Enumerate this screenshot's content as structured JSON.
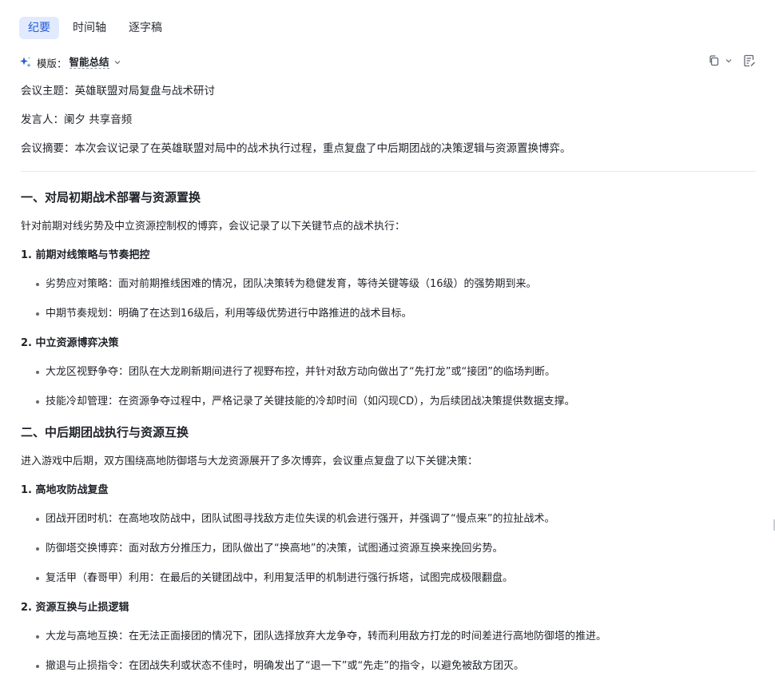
{
  "tabs": [
    {
      "label": "纪要",
      "active": true
    },
    {
      "label": "时间轴",
      "active": false
    },
    {
      "label": "逐字稿",
      "active": false
    }
  ],
  "template": {
    "label": "模版：",
    "value": "智能总结",
    "icon": "sparkle-icon"
  },
  "toolbar_icons": [
    "copy-icon",
    "chevron-down-icon",
    "edit-note-icon"
  ],
  "meta": {
    "topic": "会议主题：英雄联盟对局复盘与战术研讨",
    "speaker": "发言人：阑夕 共享音频",
    "summary": "会议摘要：本次会议记录了在英雄联盟对局中的战术执行过程，重点复盘了中后期团战的决策逻辑与资源置换博弈。"
  },
  "sections": [
    {
      "title": "一、对局初期战术部署与资源置换",
      "intro": "针对前期对线劣势及中立资源控制权的博弈，会议记录了以下关键节点的战术执行：",
      "subsections": [
        {
          "title": "1. 前期对线策略与节奏把控",
          "items": [
            "劣势应对策略：面对前期推线困难的情况，团队决策转为稳健发育，等待关键等级（16级）的强势期到来。",
            "中期节奏规划：明确了在达到16级后，利用等级优势进行中路推进的战术目标。"
          ]
        },
        {
          "title": "2. 中立资源博弈决策",
          "items": [
            "大龙区视野争夺：团队在大龙刷新期间进行了视野布控，并针对敌方动向做出了“先打龙”或“接团”的临场判断。",
            "技能冷却管理：在资源争夺过程中，严格记录了关键技能的冷却时间（如闪现CD），为后续团战决策提供数据支撑。"
          ]
        }
      ]
    },
    {
      "title": "二、中后期团战执行与资源互换",
      "intro": "进入游戏中后期，双方围绕高地防御塔与大龙资源展开了多次博弈，会议重点复盘了以下关键决策：",
      "subsections": [
        {
          "title": "1. 高地攻防战复盘",
          "items": [
            "团战开团时机：在高地攻防战中，团队试图寻找敌方走位失误的机会进行强开，并强调了“慢点来”的拉扯战术。",
            "防御塔交换博弈：面对敌方分推压力，团队做出了“换高地”的决策，试图通过资源互换来挽回劣势。",
            "复活甲（春哥甲）利用：在最后的关键团战中，利用复活甲的机制进行强行拆塔，试图完成极限翻盘。"
          ]
        },
        {
          "title": "2. 资源互换与止损逻辑",
          "items": [
            "大龙与高地互换：在无法正面接团的情况下，团队选择放弃大龙争夺，转而利用敌方打龙的时间差进行高地防御塔的推进。",
            "撤退与止损指令：在团战失利或状态不佳时，明确发出了“退一下”或“先走”的指令，以避免被敌方团灭。"
          ]
        }
      ]
    }
  ],
  "colors": {
    "accent": "#245bdb",
    "tab_active_bg": "#e1eaff",
    "text": "#1f2329",
    "divider": "#e6e8eb"
  }
}
